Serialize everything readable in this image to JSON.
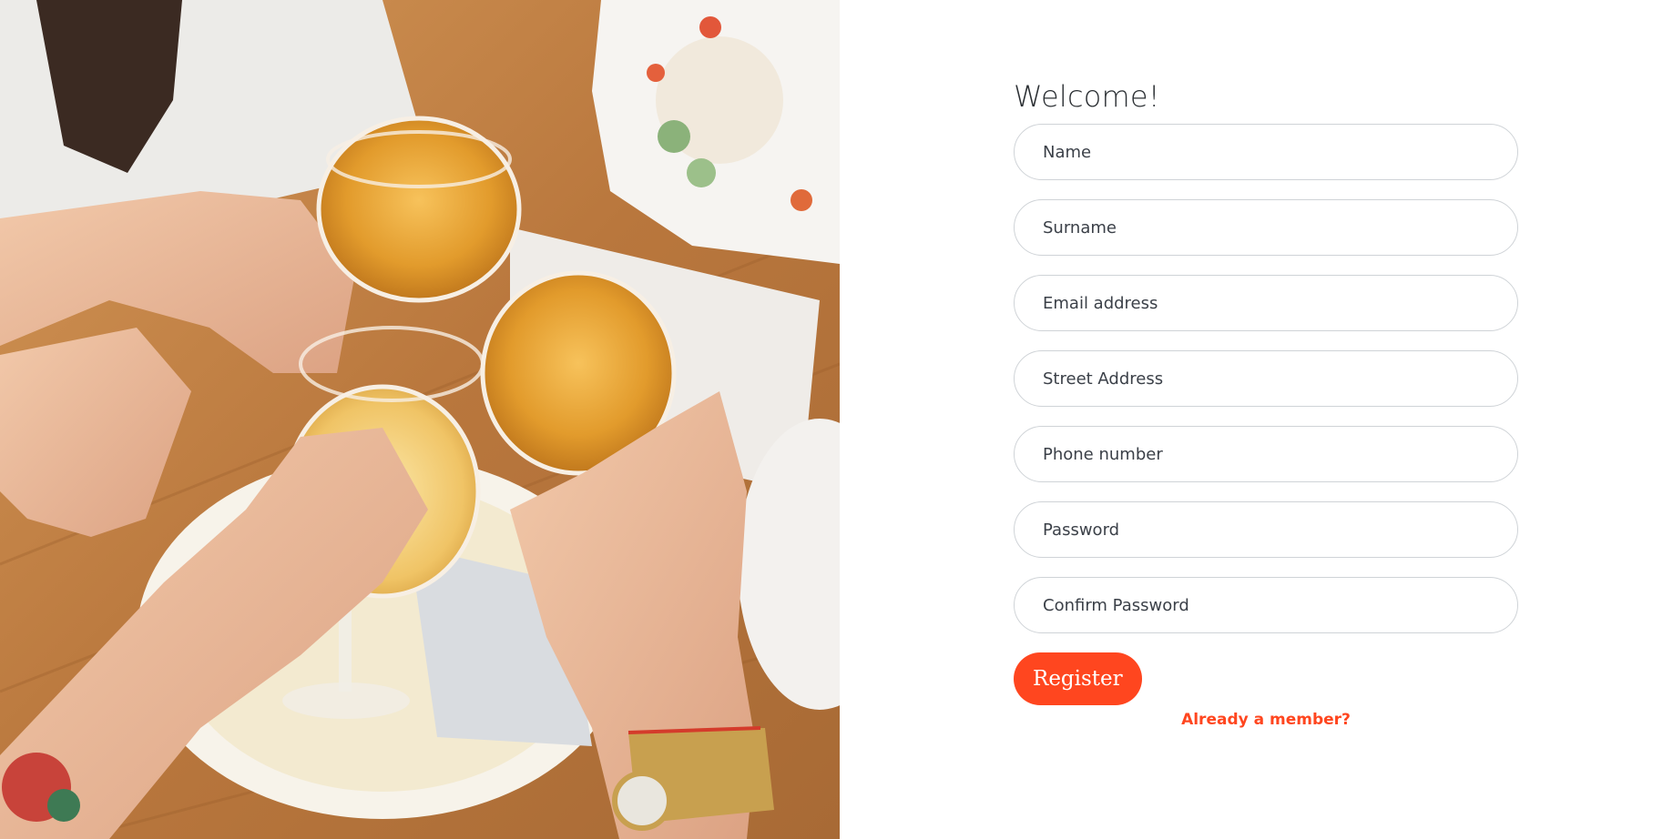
{
  "hero_image": {
    "alt": "Friends toasting with glasses of beer over a restaurant table",
    "icon": "photo-icon"
  },
  "form": {
    "title": "Welcome!",
    "fields": {
      "name": {
        "placeholder": "Name",
        "value": ""
      },
      "surname": {
        "placeholder": "Surname",
        "value": ""
      },
      "email": {
        "placeholder": "Email address",
        "value": ""
      },
      "street": {
        "placeholder": "Street Address",
        "value": ""
      },
      "phone": {
        "placeholder": "Phone number",
        "value": ""
      },
      "password": {
        "placeholder": "Password",
        "value": ""
      },
      "confirm_password": {
        "placeholder": "Confirm Password",
        "value": ""
      }
    },
    "register_label": "Register",
    "member_link": "Already a member?"
  },
  "colors": {
    "accent": "#ff461f",
    "input_border": "#cfd3d7",
    "text": "#3b4048",
    "title": "#2b2f33",
    "background": "#ffffff"
  }
}
